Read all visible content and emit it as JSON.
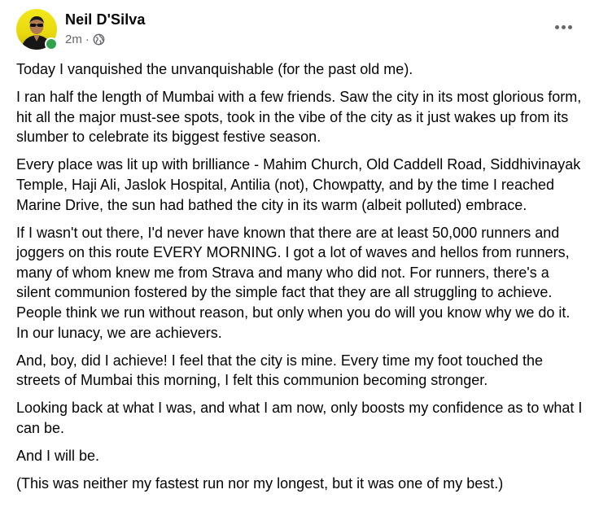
{
  "post": {
    "author": "Neil D'Silva",
    "timestamp": "2m",
    "separator": "·",
    "audience_icon": "globe-icon",
    "more_icon": "more-horizontal-icon",
    "online_status_color": "#31a24c",
    "paragraphs": [
      "Today I vanquished the unvanquishable (for the past old me).",
      "I ran half the length of Mumbai with a few friends. Saw the city in its most glorious form, hit all the major must-see spots, took in the vibe of the city as it just wakes up from its slumber to celebrate its biggest festive season.",
      "Every place was lit up with brilliance - Mahim Church, Old Caddell Road, Siddhivinayak Temple, Haji Ali, Jaslok Hospital, Antilia (not), Chowpatty, and by the time I reached Marine Drive, the sun had bathed the city in its warm (albeit polluted) embrace.",
      "If I wasn't out there, I'd never have known that there are at least 50,000 runners and joggers on this route EVERY MORNING. I got a lot of waves and hellos from runners, many of whom knew me from Strava and many who did not. For runners, there's a silent communion fostered by the simple fact that they are all struggling to achieve. People think we run without reason, but only when you do will you know why we do it. In our lunacy, we are achievers.",
      "And, boy, did I achieve! I feel that the city is mine. Every time my foot touched the streets of Mumbai this morning, I felt this communion becoming stronger.",
      "Looking back at what I was, and what I am now, only boosts my confidence as to what I can be.",
      "And I will be.",
      "(This was neither my fastest run nor my longest, but it was one of my best.)"
    ]
  }
}
